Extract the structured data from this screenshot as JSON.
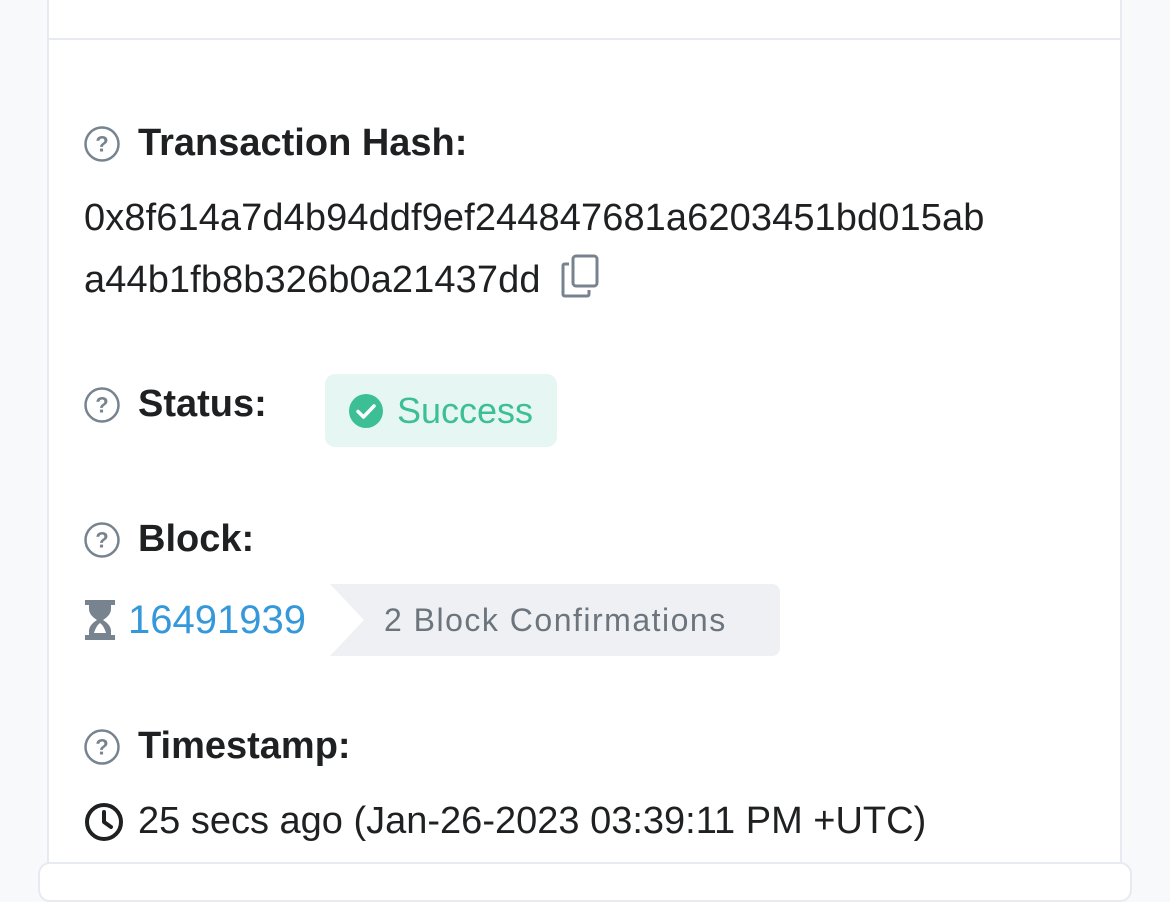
{
  "transaction": {
    "hash_label": "Transaction Hash:",
    "hash_line_1": "0x8f614a7d4b94ddf9ef244847681a6203451bd015ab",
    "hash_line_2": "a44b1fb8b326b0a21437dd",
    "status_label": "Status:",
    "status_value": "Success",
    "block_label": "Block:",
    "block_number": "16491939",
    "block_confirmations": "2 Block Confirmations",
    "timestamp_label": "Timestamp:",
    "timestamp_value": "25 secs ago (Jan-26-2023 03:39:11 PM +UTC)"
  },
  "icons": {
    "help": "question-circle-icon",
    "copy": "copy-icon",
    "status": "check-circle-icon",
    "block_pending": "hourglass-icon",
    "timestamp": "clock-icon"
  },
  "colors": {
    "success_text": "#3dbf95",
    "success_bg": "#e6f7f3",
    "link": "#3498db",
    "badge_bg": "#eef0f3",
    "badge_text": "#6c757d"
  }
}
